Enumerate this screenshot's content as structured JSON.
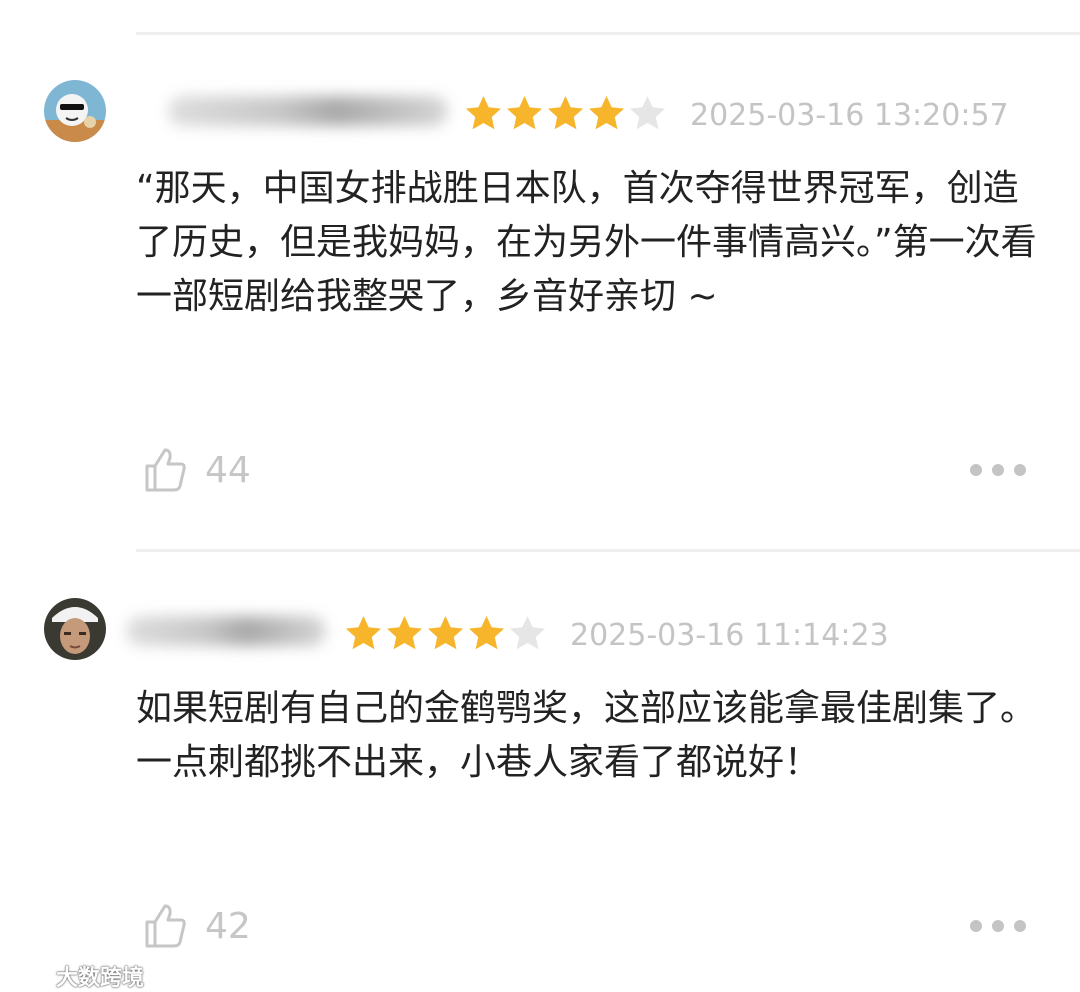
{
  "reviews": [
    {
      "rating": 4,
      "max_rating": 5,
      "timestamp": "2025-03-16 13:20:57",
      "text": "“那天，中国女排战胜日本队，首次夺得世界冠军，创造了历史，但是我妈妈，在为另外一件事情高兴。”第一次看一部短剧给我整哭了，乡音好亲切 ~",
      "likes": "44"
    },
    {
      "rating": 4,
      "max_rating": 5,
      "timestamp": "2025-03-16 11:14:23",
      "text": "如果短剧有自己的金鹤鹗奖，这部应该能拿最佳剧集了。一点刺都挑不出来，小巷人家看了都说好！",
      "likes": "42"
    }
  ],
  "watermark": "大数跨境",
  "colors": {
    "star_filled": "#f7b52c",
    "star_empty": "#e6e6e6",
    "muted_text": "#c4c4c4",
    "body_text": "#222222"
  },
  "icons": {
    "like": "thumbs-up-icon",
    "more": "more-dots-icon"
  }
}
